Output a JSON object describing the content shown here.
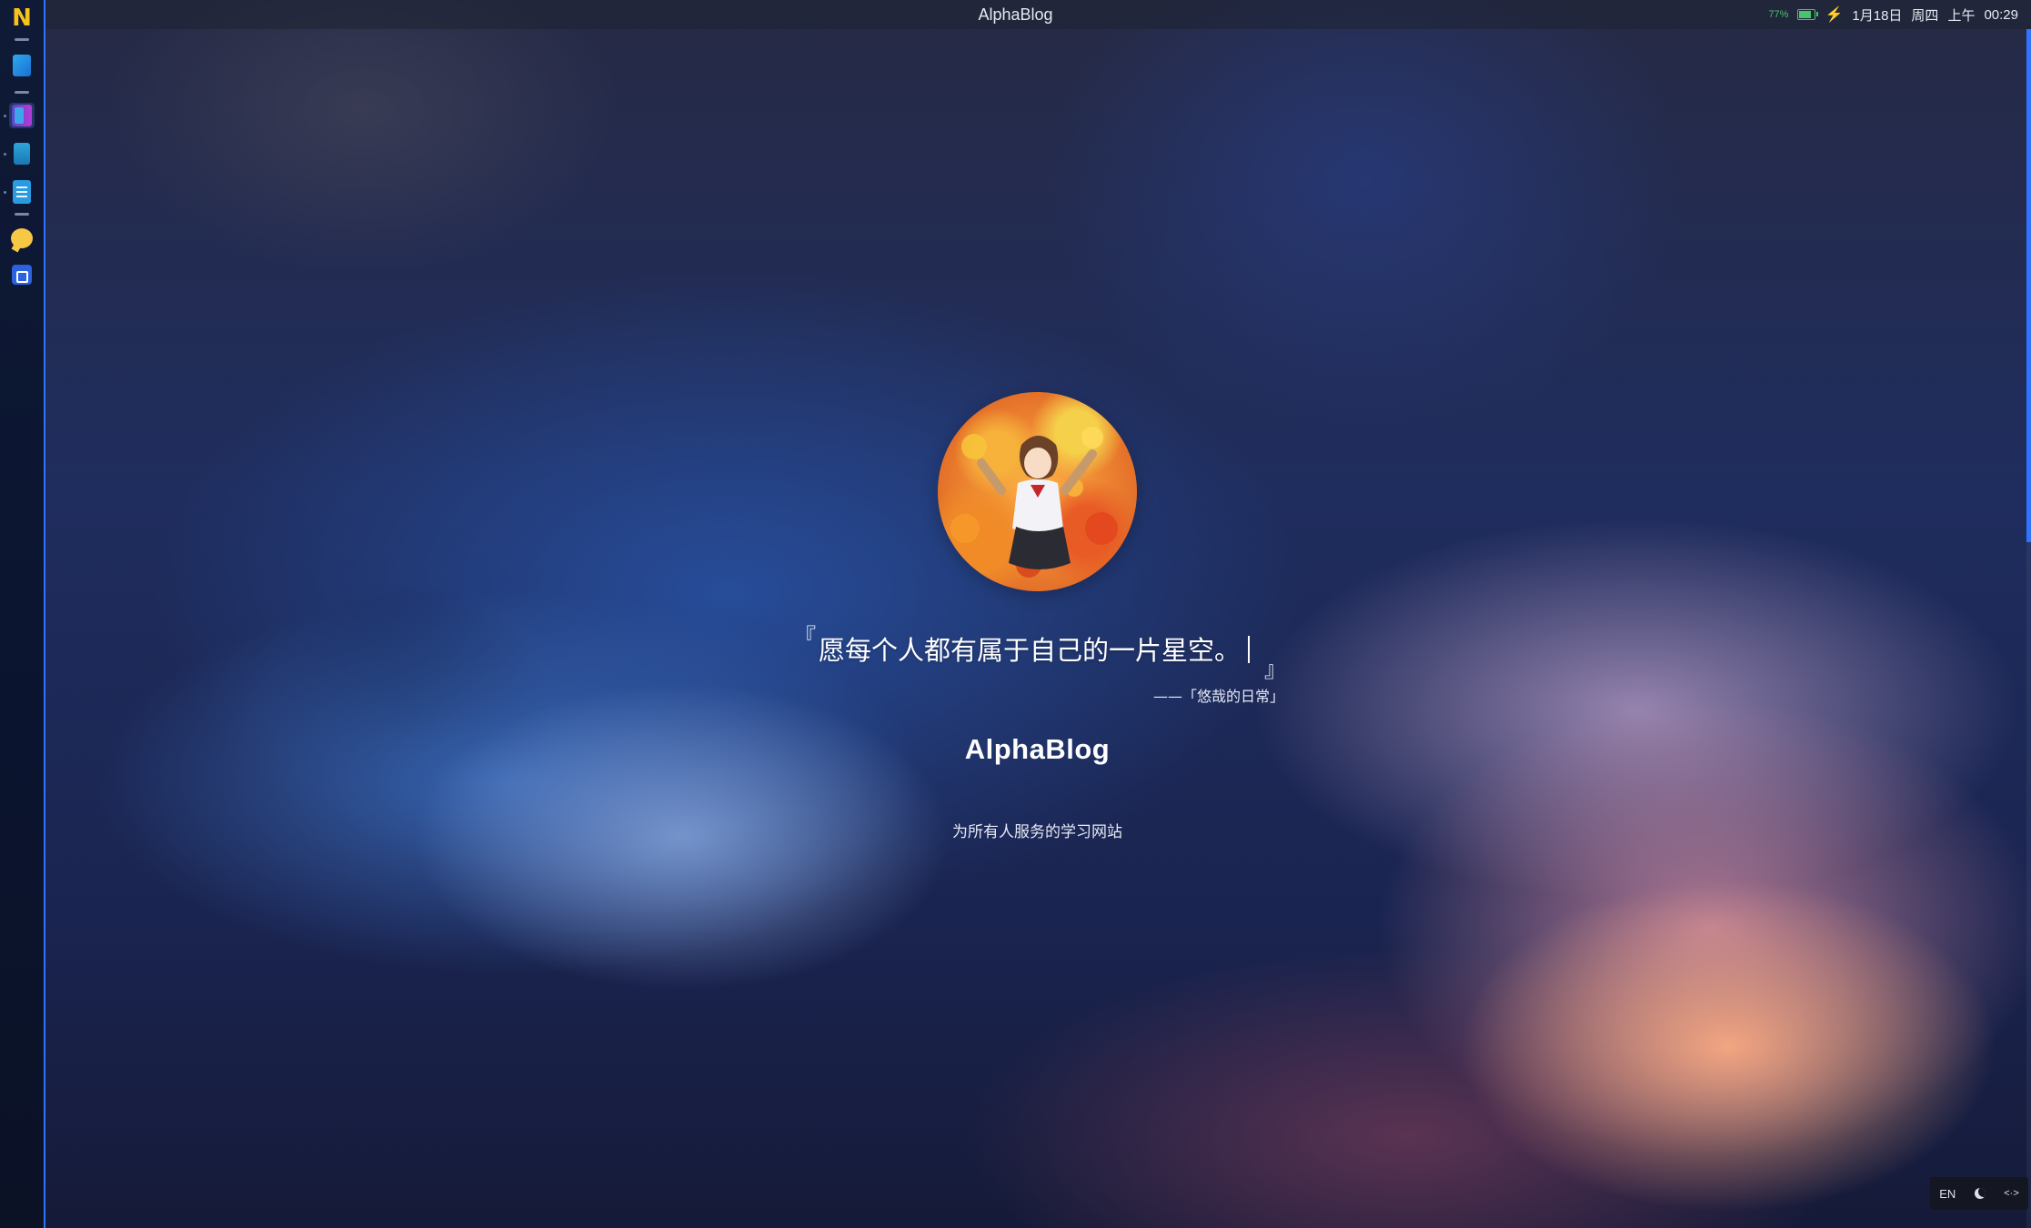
{
  "window": {
    "title": "AlphaBlog"
  },
  "tray": {
    "battery_percent": "77%",
    "date": "1月18日",
    "weekday": "周四",
    "ampm": "上午",
    "time": "00:29"
  },
  "dock": {
    "items": [
      {
        "icon": "n-logo-icon"
      },
      {
        "icon": "book-icon"
      },
      {
        "icon": "library-icon"
      },
      {
        "icon": "notebook-icon"
      },
      {
        "icon": "document-icon"
      },
      {
        "icon": "chat-bubble-icon"
      },
      {
        "icon": "extension-icon"
      }
    ],
    "accent": "#2f74ff"
  },
  "hero": {
    "avatar_icon": "avatar-anime-girl-icon",
    "quote_open": "『",
    "quote_text": "愿每个人都有属于自己的一片星空。",
    "quote_close": "』",
    "quote_source": "——「悠哉的日常」",
    "site_title": "AlphaBlog",
    "site_subtitle": "为所有人服务的学习网站"
  },
  "tools": {
    "language": "EN",
    "theme_icon": "moon-icon",
    "more_icon": "ellipsis-icon"
  }
}
